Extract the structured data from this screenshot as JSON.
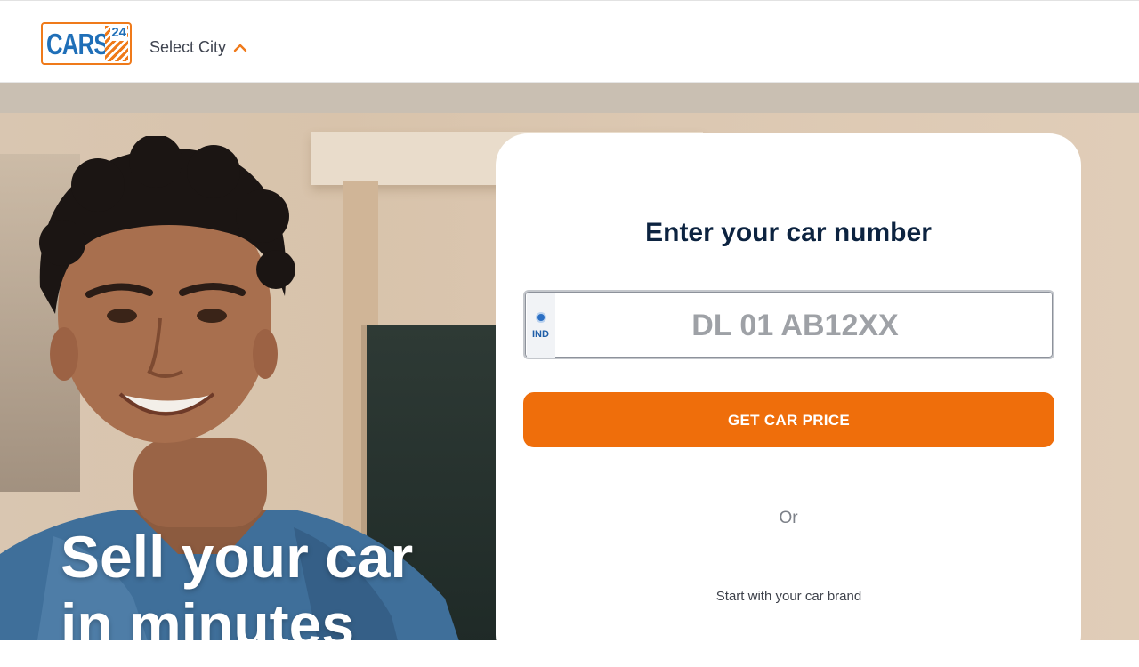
{
  "header": {
    "logo": {
      "text": "CARS",
      "number": "24"
    },
    "city_selector": {
      "label": "Select City",
      "icon": "chevron-up-icon"
    }
  },
  "hero": {
    "headline_line1": "Sell your car",
    "headline_line2": "in minutes"
  },
  "form": {
    "title": "Enter your car number",
    "plate_country": "IND",
    "plate_placeholder": "DL 01 AB12XX",
    "plate_value": "",
    "submit_label": "GET CAR PRICE",
    "divider_text": "Or",
    "brand_prompt": "Start with your car brand"
  },
  "colors": {
    "brand_orange": "#ef6e0b",
    "brand_blue": "#1f6fb8",
    "title_navy": "#0c2340"
  }
}
